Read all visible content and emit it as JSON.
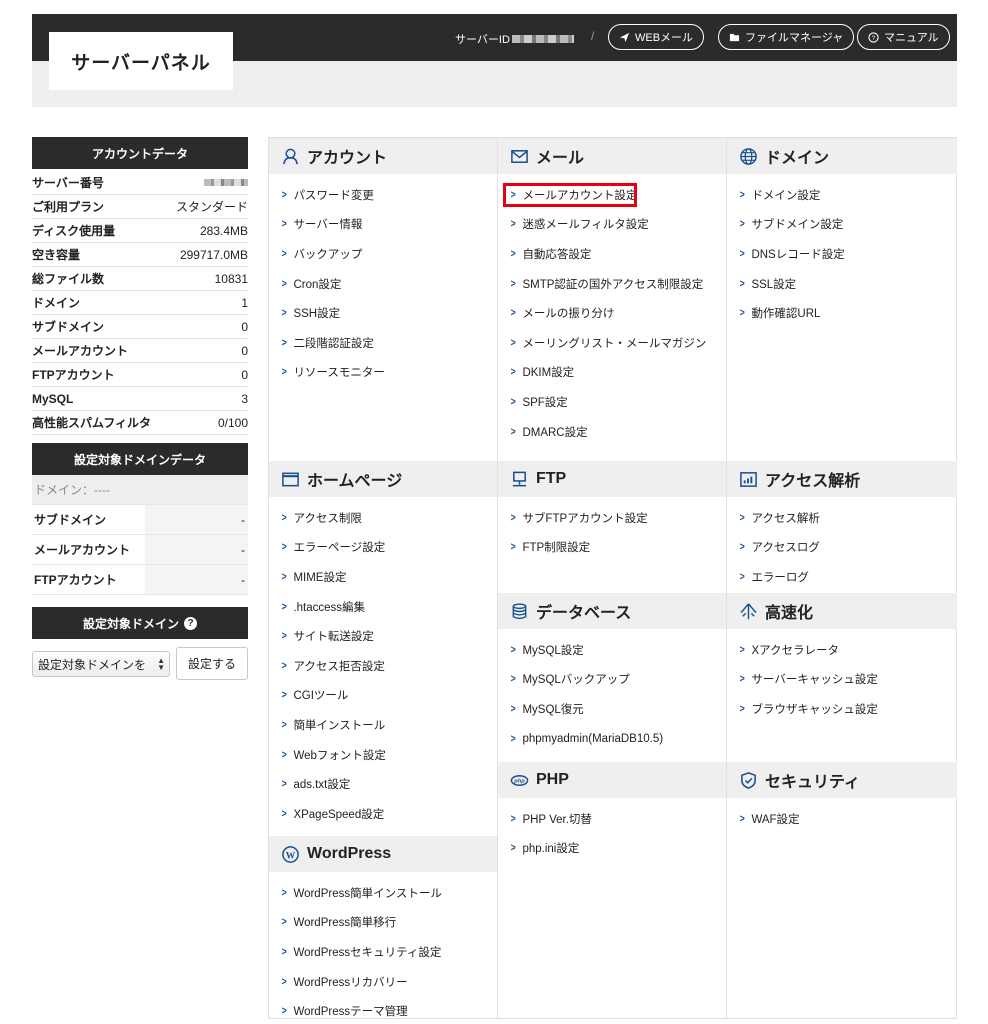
{
  "header": {
    "logo": "サーバーパネル",
    "server_id_label": "サーバーID",
    "separator": "/",
    "links": {
      "webmail": "WEBメール",
      "file_manager": "ファイルマネージャ",
      "manual": "マニュアル"
    }
  },
  "sidebar": {
    "account_title": "アカウントデータ",
    "account_rows": [
      {
        "label": "サーバー番号",
        "value": ""
      },
      {
        "label": "ご利用プラン",
        "value": "スタンダード"
      },
      {
        "label": "ディスク使用量",
        "value": "283.4MB"
      },
      {
        "label": "空き容量",
        "value": "299717.0MB"
      },
      {
        "label": "総ファイル数",
        "value": "10831"
      },
      {
        "label": "ドメイン",
        "value": "1"
      },
      {
        "label": "サブドメイン",
        "value": "0"
      },
      {
        "label": "メールアカウント",
        "value": "0"
      },
      {
        "label": "FTPアカウント",
        "value": "0"
      },
      {
        "label": "MySQL",
        "value": "3"
      },
      {
        "label": "高性能スパムフィルタ",
        "value": "0/100"
      }
    ],
    "domain_data_title": "設定対象ドメインデータ",
    "domain_rows": [
      {
        "label": "ドメイン：----",
        "value": ""
      },
      {
        "label": "サブドメイン",
        "value": "-"
      },
      {
        "label": "メールアカウント",
        "value": "-"
      },
      {
        "label": "FTPアカウント",
        "value": "-"
      }
    ],
    "target_domain_title": "設定対象ドメイン",
    "select_value": "設定対象ドメインを",
    "submit_label": "設定する"
  },
  "sections": {
    "account": {
      "title": "アカウント",
      "items": [
        "パスワード変更",
        "サーバー情報",
        "バックアップ",
        "Cron設定",
        "SSH設定",
        "二段階認証設定",
        "リソースモニター"
      ]
    },
    "mail": {
      "title": "メール",
      "items": [
        "メールアカウント設定",
        "迷惑メールフィルタ設定",
        "自動応答設定",
        "SMTP認証の国外アクセス制限設定",
        "メールの振り分け",
        "メーリングリスト・メールマガジン",
        "DKIM設定",
        "SPF設定",
        "DMARC設定"
      ]
    },
    "domain": {
      "title": "ドメイン",
      "items": [
        "ドメイン設定",
        "サブドメイン設定",
        "DNSレコード設定",
        "SSL設定",
        "動作確認URL"
      ]
    },
    "homepage": {
      "title": "ホームページ",
      "items": [
        "アクセス制限",
        "エラーページ設定",
        "MIME設定",
        ".htaccess編集",
        "サイト転送設定",
        "アクセス拒否設定",
        "CGIツール",
        "簡単インストール",
        "Webフォント設定",
        "ads.txt設定",
        "XPageSpeed設定"
      ]
    },
    "ftp": {
      "title": "FTP",
      "items": [
        "サブFTPアカウント設定",
        "FTP制限設定"
      ]
    },
    "analytics": {
      "title": "アクセス解析",
      "items": [
        "アクセス解析",
        "アクセスログ",
        "エラーログ"
      ]
    },
    "database": {
      "title": "データベース",
      "items": [
        "MySQL設定",
        "MySQLバックアップ",
        "MySQL復元",
        "phpmyadmin(MariaDB10.5)"
      ]
    },
    "speed": {
      "title": "高速化",
      "items": [
        "Xアクセラレータ",
        "サーバーキャッシュ設定",
        "ブラウザキャッシュ設定"
      ]
    },
    "php": {
      "title": "PHP",
      "items": [
        "PHP Ver.切替",
        "php.ini設定"
      ]
    },
    "security": {
      "title": "セキュリティ",
      "items": [
        "WAF設定"
      ]
    },
    "wordpress": {
      "title": "WordPress",
      "items": [
        "WordPress簡単インストール",
        "WordPress簡単移行",
        "WordPressセキュリティ設定",
        "WordPressリカバリー",
        "WordPressテーマ管理"
      ]
    }
  },
  "colors": {
    "header_bg": "#2b2b2b",
    "chevron": "#1a4f8f",
    "highlight": "#e60012"
  }
}
